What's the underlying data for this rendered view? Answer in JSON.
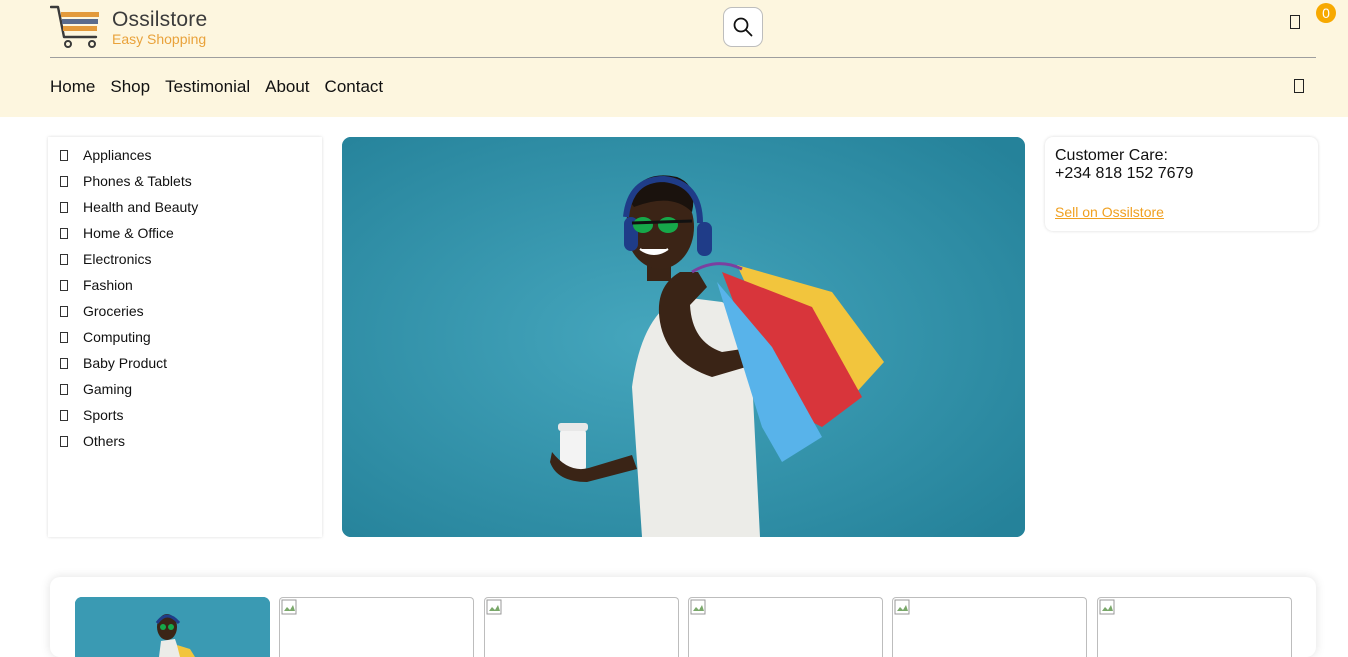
{
  "brand": {
    "name": "Ossilstore",
    "tagline": "Easy Shopping",
    "colors": {
      "header_bg": "#fdf6df",
      "accent": "#f7a900",
      "link": "#f0a020",
      "hero_bg": "#2f8fa6"
    }
  },
  "header": {
    "search_icon": "search-icon",
    "cart_icon": "cart-icon",
    "cart_count": "0",
    "menu_icon": "menu-icon"
  },
  "nav": {
    "items": [
      "Home",
      "Shop",
      "Testimonial",
      "About",
      "Contact"
    ]
  },
  "categories": {
    "items": [
      "Appliances",
      "Phones & Tablets",
      "Health and Beauty",
      "Home & Office",
      "Electronics",
      "Fashion",
      "Groceries",
      "Computing",
      "Baby Product",
      "Gaming",
      "Sports",
      "Others"
    ]
  },
  "care": {
    "title": "Customer Care:",
    "phone": "+234 818 152 7679",
    "sell_link": "Sell on Ossilstore"
  }
}
